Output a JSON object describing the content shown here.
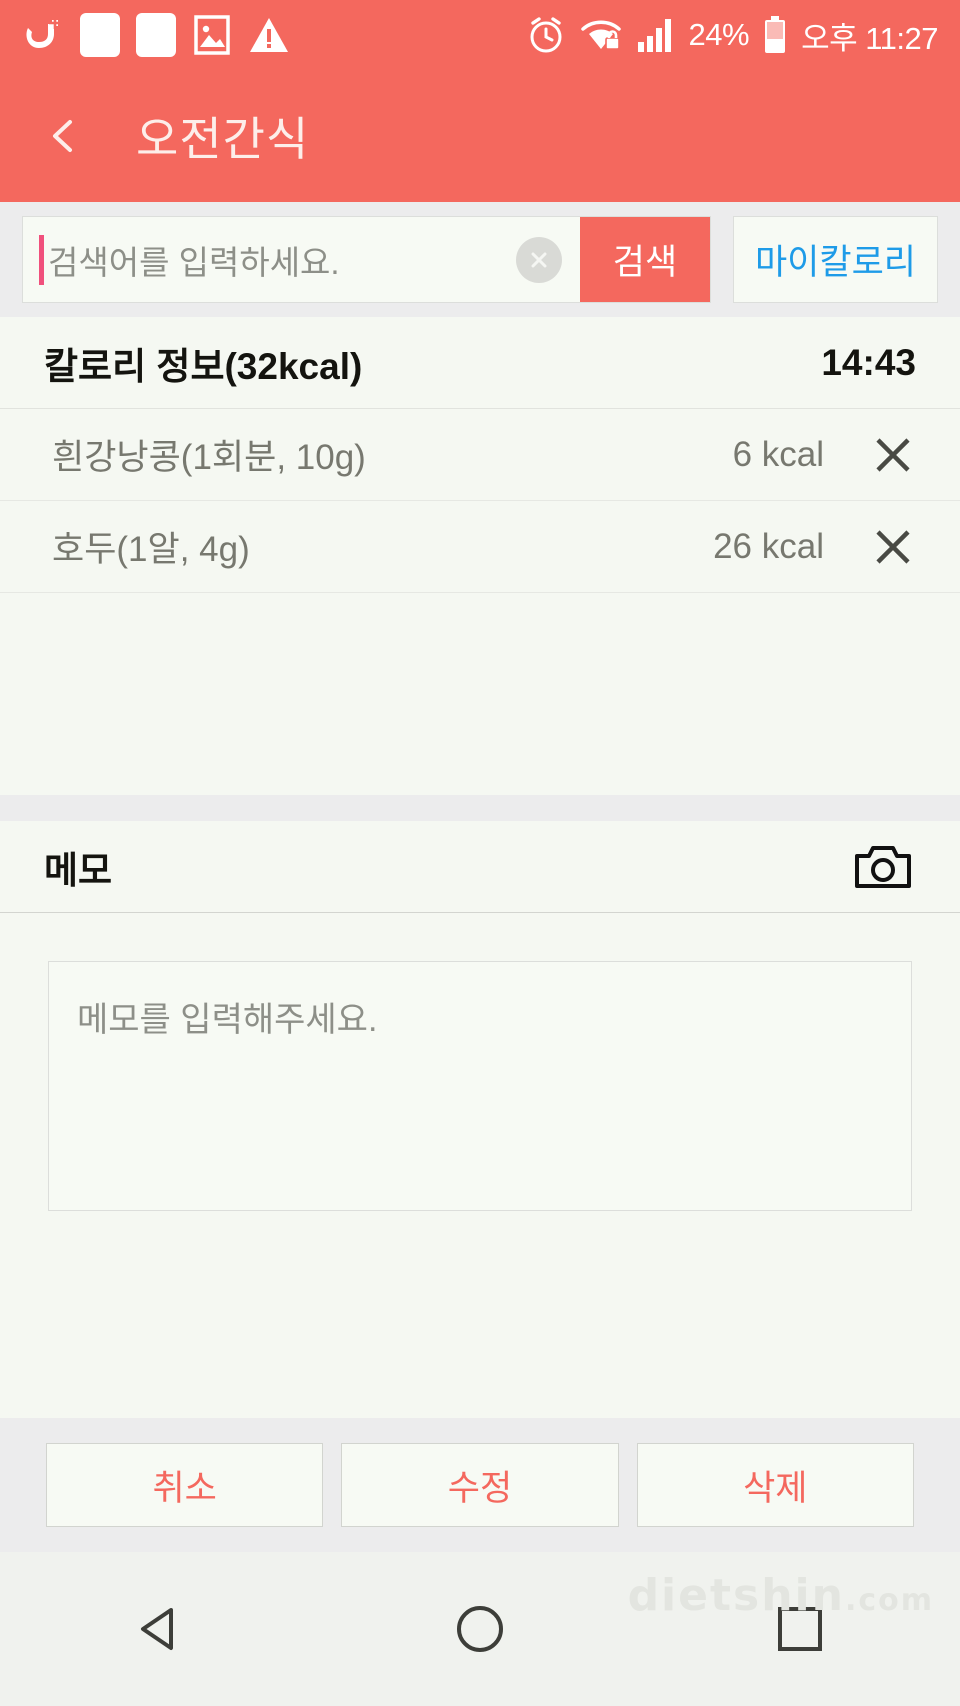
{
  "status_bar": {
    "icons_left": [
      "uplus-logo-icon",
      "blank-square-icon",
      "blank-square-icon",
      "image-icon",
      "warning-triangle-icon"
    ],
    "alarm_icon": "alarm-clock-icon",
    "wifi_icon": "wifi-locked-icon",
    "signal_icon": "signal-bars-icon",
    "battery_percent": "24%",
    "battery_icon": "battery-low-icon",
    "time": "오후 11:27"
  },
  "header": {
    "back_icon": "chevron-left-icon",
    "title": "오전간식"
  },
  "search": {
    "placeholder": "검색어를 입력하세요.",
    "value": "",
    "clear_icon": "close-circle-icon",
    "search_button": "검색",
    "mycalorie_button": "마이칼로리"
  },
  "calorie_info": {
    "title": "칼로리 정보(32kcal)",
    "total_kcal": 32,
    "time": "14:43"
  },
  "foods": [
    {
      "name": "흰강낭콩(1회분, 10g)",
      "kcal": "6 kcal",
      "delete_icon": "close-x-icon"
    },
    {
      "name": "호두(1알, 4g)",
      "kcal": "26 kcal",
      "delete_icon": "close-x-icon"
    }
  ],
  "memo": {
    "title": "메모",
    "camera_icon": "camera-icon",
    "placeholder": "메모를 입력해주세요.",
    "value": ""
  },
  "actions": {
    "cancel": "취소",
    "edit": "수정",
    "delete": "삭제"
  },
  "navigation": {
    "back_icon": "nav-back-triangle-icon",
    "home_icon": "nav-home-circle-icon",
    "recents_icon": "nav-recents-square-icon"
  },
  "watermark": {
    "text": "dietshin",
    "suffix": ".com"
  },
  "colors": {
    "accent_red": "#f4685e",
    "link_blue": "#1e9be8",
    "page_bg": "#f5f8f2",
    "band_gray": "#ececed",
    "muted_text": "#77786f"
  }
}
